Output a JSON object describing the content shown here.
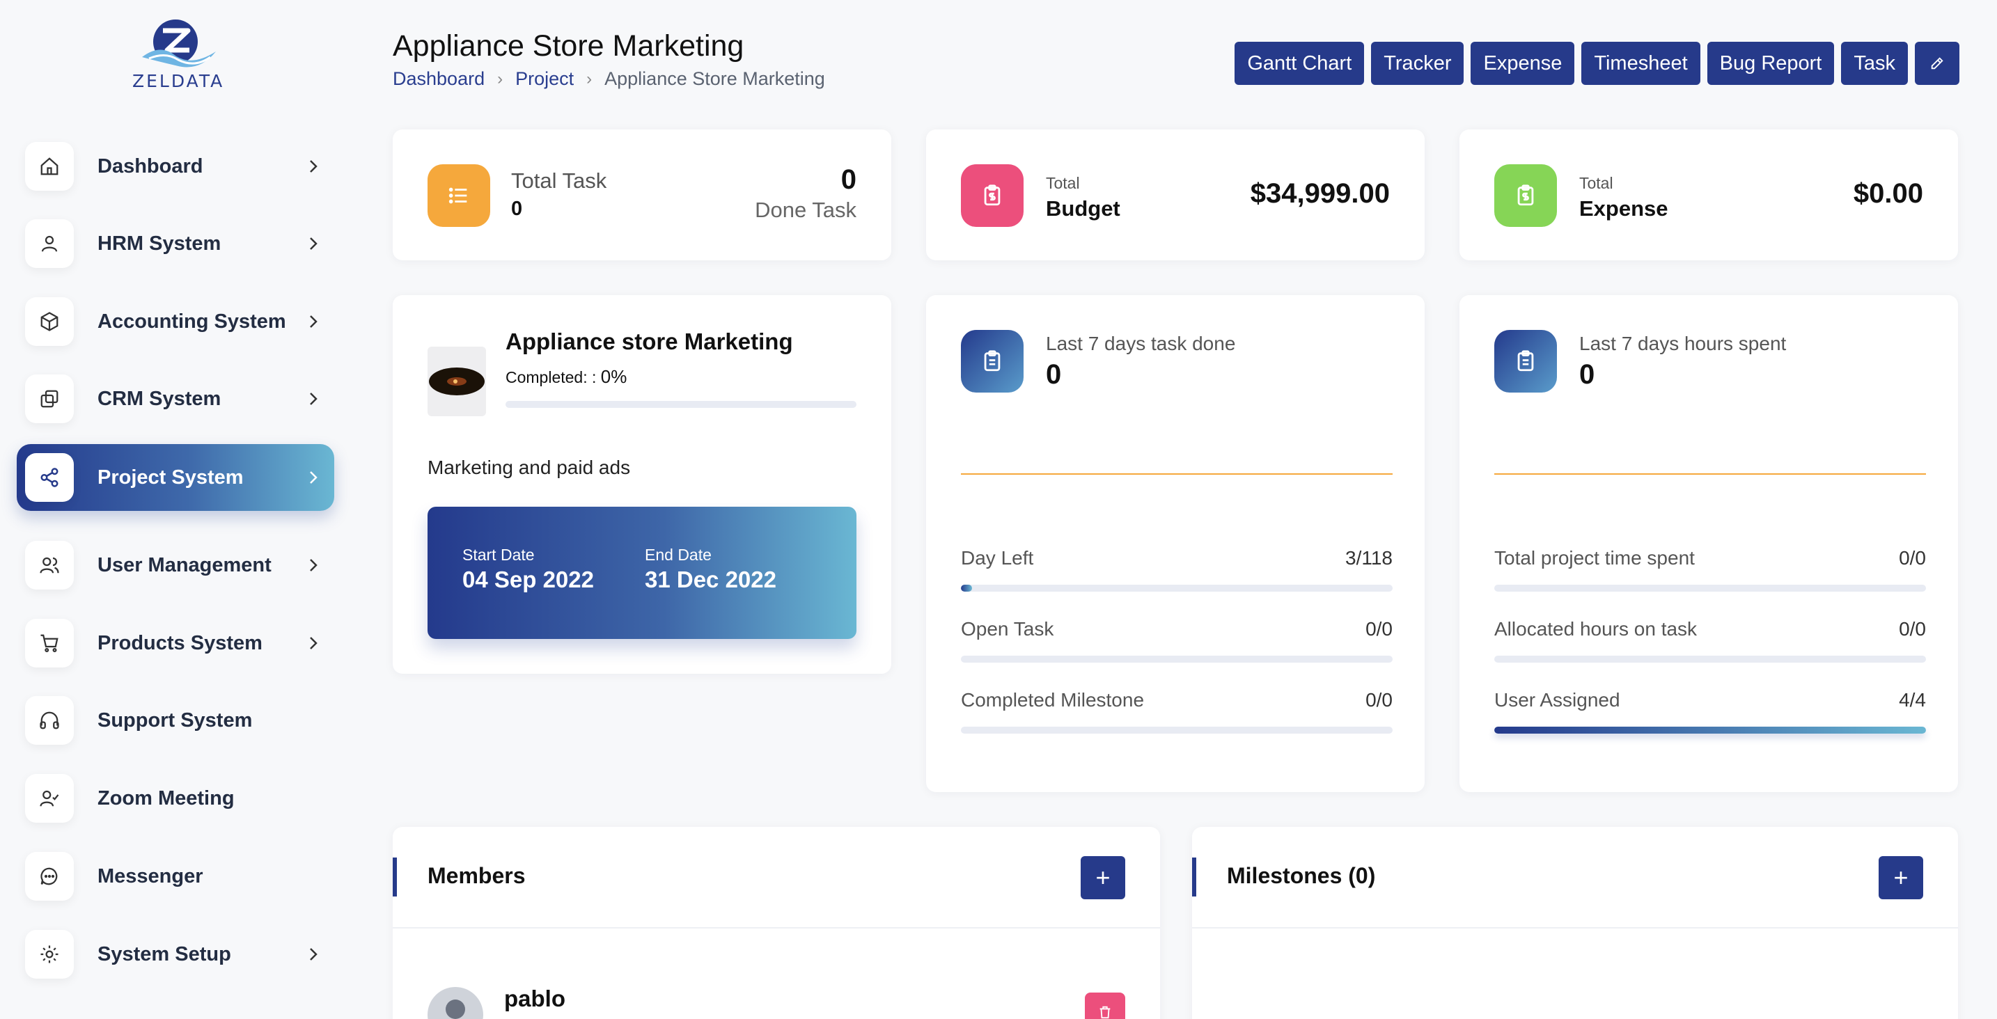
{
  "logo": {
    "text": "ZELDATA"
  },
  "sidebar": {
    "items": [
      {
        "label": "Dashboard",
        "icon": "home-icon",
        "chevron": true
      },
      {
        "label": "HRM System",
        "icon": "user-icon",
        "chevron": true
      },
      {
        "label": "Accounting System",
        "icon": "box-icon",
        "chevron": true
      },
      {
        "label": "CRM System",
        "icon": "layers-icon",
        "chevron": true
      },
      {
        "label": "Project System",
        "icon": "share-icon",
        "chevron": true,
        "active": true
      },
      {
        "label": "User Management",
        "icon": "users-icon",
        "chevron": true
      },
      {
        "label": "Products System",
        "icon": "cart-icon",
        "chevron": true
      },
      {
        "label": "Support System",
        "icon": "headphones-icon",
        "chevron": false
      },
      {
        "label": "Zoom Meeting",
        "icon": "user-check-icon",
        "chevron": false
      },
      {
        "label": "Messenger",
        "icon": "message-icon",
        "chevron": false
      },
      {
        "label": "System Setup",
        "icon": "gear-icon",
        "chevron": true
      }
    ]
  },
  "header": {
    "title": "Appliance Store Marketing",
    "breadcrumb": [
      "Dashboard",
      "Project",
      "Appliance Store Marketing"
    ]
  },
  "toolbar": {
    "buttons": [
      "Gantt Chart",
      "Tracker",
      "Expense",
      "Timesheet",
      "Bug Report",
      "Task"
    ],
    "edit_icon": "pencil-icon"
  },
  "summary": {
    "task": {
      "label": "Total Task",
      "total": "0",
      "done_value": "0",
      "done_label": "Done Task"
    },
    "budget": {
      "small": "Total",
      "label": "Budget",
      "value": "$34,999.00"
    },
    "expense": {
      "small": "Total",
      "label": "Expense",
      "value": "$0.00"
    }
  },
  "project": {
    "name": "Appliance store Marketing",
    "completed_label": "Completed: :",
    "completed_value": "0%",
    "completed_fraction": 0,
    "description": "Marketing and paid ads",
    "start_label": "Start Date",
    "start_date": "04 Sep 2022",
    "end_label": "End Date",
    "end_date": "31 Dec 2022"
  },
  "tasks_card": {
    "label": "Last 7 days task done",
    "value": "0",
    "stats": [
      {
        "label": "Day Left",
        "value": "3/118",
        "fraction": 0.025
      },
      {
        "label": "Open Task",
        "value": "0/0",
        "fraction": 0
      },
      {
        "label": "Completed Milestone",
        "value": "0/0",
        "fraction": 0
      }
    ]
  },
  "hours_card": {
    "label": "Last 7 days hours spent",
    "value": "0",
    "stats": [
      {
        "label": "Total project time spent",
        "value": "0/0",
        "fraction": 0
      },
      {
        "label": "Allocated hours on task",
        "value": "0/0",
        "fraction": 0
      },
      {
        "label": "User Assigned",
        "value": "4/4",
        "fraction": 1
      }
    ]
  },
  "members": {
    "title": "Members",
    "list": [
      {
        "name": "pablo"
      }
    ]
  },
  "milestones": {
    "title": "Milestones (0)"
  },
  "colors": {
    "primary": "#263a8a",
    "orange": "#f5a83c",
    "pink": "#ec4f7c",
    "green": "#86d556",
    "accent_line": "#f5a83c"
  }
}
